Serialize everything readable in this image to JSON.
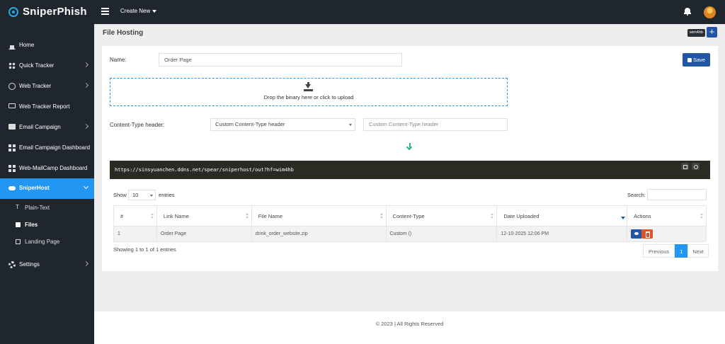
{
  "app": {
    "name": "SniperPhish"
  },
  "topbar": {
    "create_new": "Create New",
    "user_tag": "wim4hb"
  },
  "sidebar": {
    "items": [
      {
        "label": "Home",
        "icon": "home-icon"
      },
      {
        "label": "Quick Tracker",
        "icon": "tracker-icon"
      },
      {
        "label": "Web Tracker",
        "icon": "globe-icon"
      },
      {
        "label": "Web Tracker Report",
        "icon": "laptop-icon"
      },
      {
        "label": "Email Campaign",
        "icon": "mail-icon"
      },
      {
        "label": "Email Campaign Dashboard",
        "icon": "dashboard-icon"
      },
      {
        "label": "Web-MailCamp Dashboard",
        "icon": "dashboard-icon"
      },
      {
        "label": "SniperHost",
        "icon": "cloud-icon"
      },
      {
        "label": "Settings",
        "icon": "gear-icon"
      }
    ],
    "sniperhost_sub": [
      {
        "label": "Plain-Text",
        "icon": "text-icon"
      },
      {
        "label": "Files",
        "icon": "file-icon"
      },
      {
        "label": "Landing Page",
        "icon": "page-icon"
      }
    ]
  },
  "page": {
    "title": "File Hosting"
  },
  "form": {
    "name_label": "Name:",
    "name_value": "Order Page",
    "save_label": "Save",
    "drop_text": "Drop the binary here or click to upload",
    "content_type_label": "Content-Type header:",
    "content_type_selected": "Custom Content-Type header",
    "content_type_placeholder": "Custom Content-Type header",
    "url": "https://sinsyuanchen.ddns.net/spear/sniperhost/out?hf=wim4hb"
  },
  "table": {
    "show_label": "Show",
    "page_size": "10",
    "entries_label": "entries",
    "search_label": "Search:",
    "columns": [
      "#",
      "Link Name",
      "File Name",
      "Content-Type",
      "Date Uploaded",
      "Actions"
    ],
    "rows": [
      {
        "num": "1",
        "link_name": "Order Page",
        "file_name": "drink_order_website.zip",
        "content_type": "Custom ()",
        "date_uploaded": "12-10-2025 12:06 PM"
      }
    ],
    "showing": "Showing 1 to 1 of 1 entries",
    "pagination": {
      "prev": "Previous",
      "current": "1",
      "next": "Next"
    }
  },
  "footer": {
    "text": "© 2023 | All Rights Reserved"
  },
  "colors": {
    "accent": "#2196f3",
    "primary_button": "#2255a4",
    "danger": "#da542e",
    "sidebar_bg": "#1f262d"
  }
}
